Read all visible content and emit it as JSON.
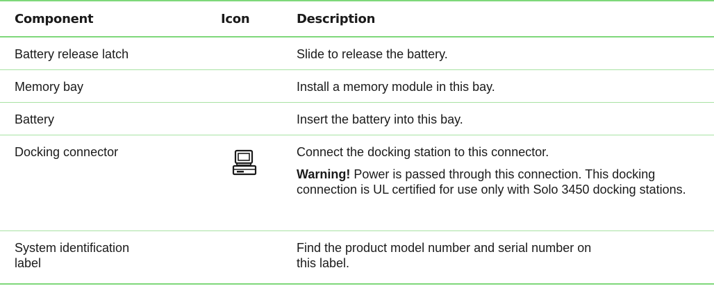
{
  "table": {
    "headers": {
      "component": "Component",
      "icon": "Icon",
      "description": "Description"
    },
    "rows": [
      {
        "component": "Battery release latch",
        "description": "Slide to release the battery."
      },
      {
        "component": "Memory bay",
        "description": "Install a memory module in this bay."
      },
      {
        "component": "Battery",
        "description": "Insert the battery into this bay."
      },
      {
        "component": "Docking connector",
        "icon": "computer-icon",
        "description": "Connect the docking station to this connector.",
        "warning_label": "Warning!",
        "warning_text": " Power is passed through this connection. This docking connection is UL certified for use only with Solo 3450 docking stations."
      },
      {
        "component_line1": "System identification",
        "component_line2": "label",
        "description_line1": "Find the product model number and serial number on",
        "description_line2": "this label."
      }
    ]
  },
  "colors": {
    "rule": "#7ed87a",
    "row_rule": "#a7e2a2"
  }
}
